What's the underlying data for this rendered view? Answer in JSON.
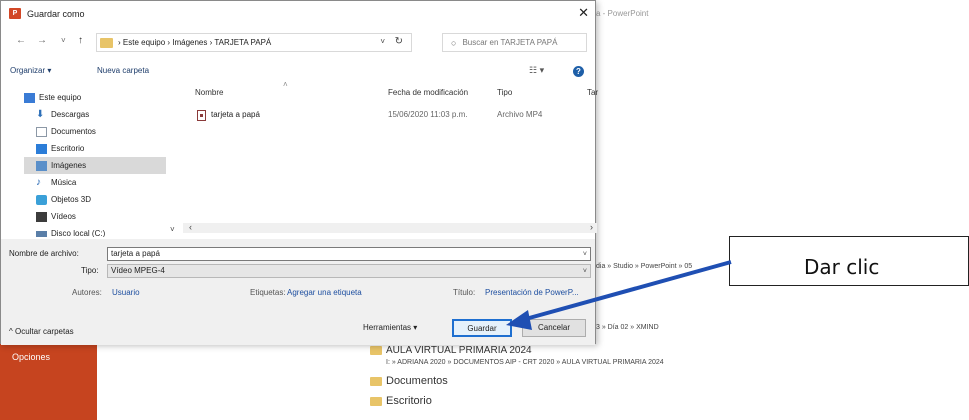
{
  "background": {
    "window_title": "a - PowerPoint",
    "sidebar_label": "Opciones",
    "partial_path_1": "dia » Studio » PowerPoint » 05",
    "partial_path_2": "3 » Día 02 » XMIND",
    "recent_items": [
      {
        "name": "AULA VIRTUAL PRIMARIA 2024",
        "path": "I: » ADRIANA 2020 » DOCUMENTOS AIP - CRT 2020 » AULA VIRTUAL PRIMARIA 2024"
      },
      {
        "name": "Documentos"
      },
      {
        "name": "Escritorio"
      }
    ]
  },
  "dialog": {
    "title": "Guardar como",
    "app_icon_letter": "P",
    "close_glyph": "✕",
    "nav": {
      "back": "←",
      "forward": "→",
      "recent": "˅",
      "up": "↑",
      "breadcrumb": "› Este equipo › Imágenes › TARJETA PAPÁ",
      "dropdown": "˅",
      "refresh": "↻",
      "search_placeholder": "Buscar en TARJETA PAPÁ"
    },
    "toolbar": {
      "organize": "Organizar ▾",
      "new_folder": "Nueva carpeta",
      "view": "☷ ▾",
      "help": "?"
    },
    "sidebar": [
      {
        "label": "Este equipo",
        "icon": "computer-icon",
        "color": "#3a7bd5"
      },
      {
        "label": "Descargas",
        "icon": "downloads-icon",
        "color": "#2d6fb8"
      },
      {
        "label": "Documentos",
        "icon": "documents-icon",
        "color": "#8c98a6"
      },
      {
        "label": "Escritorio",
        "icon": "desktop-icon",
        "color": "#2b7dd8"
      },
      {
        "label": "Imágenes",
        "icon": "pictures-icon",
        "color": "#5a8fc9",
        "selected": true
      },
      {
        "label": "Música",
        "icon": "music-icon",
        "color": "#1e62b0"
      },
      {
        "label": "Objetos 3D",
        "icon": "objects3d-icon",
        "color": "#3aa0d8"
      },
      {
        "label": "Vídeos",
        "icon": "videos-icon",
        "color": "#3c3c3c"
      },
      {
        "label": "Disco local (C:)",
        "icon": "drive-icon",
        "color": "#5a7fa8"
      }
    ],
    "columns": [
      "Nombre",
      "Fecha de modificación",
      "Tipo",
      "Tar"
    ],
    "files": [
      {
        "name": "tarjeta a papá",
        "date": "15/06/2020 11:03 p.m.",
        "type": "Archivo MP4"
      }
    ],
    "form": {
      "filename_label": "Nombre de archivo:",
      "filename_value": "tarjeta a papá",
      "type_label": "Tipo:",
      "type_value": "Vídeo MPEG-4",
      "authors_label": "Autores:",
      "authors_value": "Usuario",
      "tags_label": "Etiquetas:",
      "tags_value": "Agregar una etiqueta",
      "title_label": "Título:",
      "title_value": "Presentación de PowerP..."
    },
    "footer": {
      "hide_folders": "^ Ocultar carpetas",
      "tools": "Herramientas ▾",
      "save": "Guardar",
      "cancel": "Cancelar"
    }
  },
  "annotation": {
    "callout_text": "Dar clic",
    "arrow_color": "#1f4fb3"
  }
}
